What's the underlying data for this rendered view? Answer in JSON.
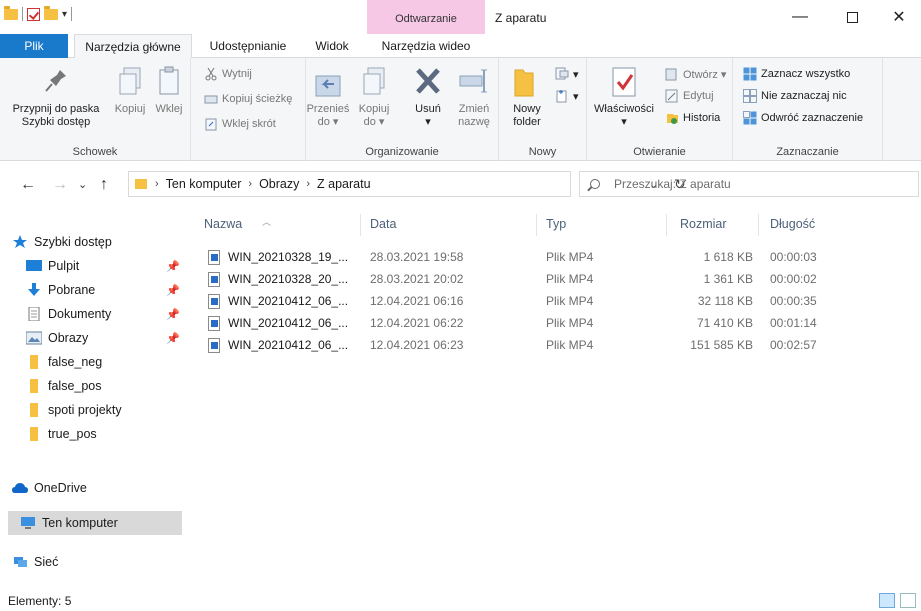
{
  "window": {
    "title": "Z aparatu",
    "context_tab_group": "Odtwarzanie",
    "minimize": "—",
    "close": "✕"
  },
  "tabs": {
    "file": "Plik",
    "home": "Narzędzia główne",
    "share": "Udostępnianie",
    "view": "Widok",
    "video": "Narzędzia wideo"
  },
  "ribbon": {
    "clipboard": {
      "label": "Schowek",
      "pin_line1": "Przypnij do paska",
      "pin_line2": "Szybki dostęp",
      "copy": "Kopiuj",
      "paste": "Wklej",
      "cut": "Wytnij",
      "copy_path": "Kopiuj ścieżkę",
      "paste_shortcut": "Wklej skrót"
    },
    "organize": {
      "label": "Organizowanie",
      "move_line1": "Przenieś",
      "move_line2": "do ▾",
      "copyto_line1": "Kopiuj",
      "copyto_line2": "do ▾",
      "delete_line1": "Usuń",
      "delete_line2": "▾",
      "rename_line1": "Zmień",
      "rename_line2": "nazwę"
    },
    "new": {
      "label": "Nowy",
      "new_folder_line1": "Nowy",
      "new_folder_line2": "folder"
    },
    "open": {
      "label": "Otwieranie",
      "properties_line1": "Właściwości",
      "properties_line2": "▾",
      "open": "Otwórz ▾",
      "edit": "Edytuj",
      "history": "Historia"
    },
    "select": {
      "label": "Zaznaczanie",
      "select_all": "Zaznacz wszystko",
      "select_none": "Nie zaznaczaj nic",
      "invert": "Odwróć zaznaczenie"
    }
  },
  "address": {
    "crumbs": [
      "Ten komputer",
      "Obrazy",
      "Z aparatu"
    ],
    "search_placeholder": "Przeszukaj: Z aparatu"
  },
  "sidebar": {
    "quick_access": "Szybki dostęp",
    "items": [
      {
        "label": "Pulpit",
        "pinned": true
      },
      {
        "label": "Pobrane",
        "pinned": true
      },
      {
        "label": "Dokumenty",
        "pinned": true
      },
      {
        "label": "Obrazy",
        "pinned": true
      },
      {
        "label": "false_neg",
        "pinned": false
      },
      {
        "label": "false_pos",
        "pinned": false
      },
      {
        "label": "spoti projekty",
        "pinned": false
      },
      {
        "label": "true_pos",
        "pinned": false
      }
    ],
    "onedrive": "OneDrive",
    "this_pc": "Ten komputer",
    "network": "Sieć"
  },
  "columns": {
    "name": "Nazwa",
    "date": "Data",
    "type": "Typ",
    "size": "Rozmiar",
    "duration": "Długość"
  },
  "files": [
    {
      "name": "WIN_20210328_19_...",
      "date": "28.03.2021 19:58",
      "type": "Plik MP4",
      "size": "1 618 KB",
      "duration": "00:00:03"
    },
    {
      "name": "WIN_20210328_20_...",
      "date": "28.03.2021 20:02",
      "type": "Plik MP4",
      "size": "1 361 KB",
      "duration": "00:00:02"
    },
    {
      "name": "WIN_20210412_06_...",
      "date": "12.04.2021 06:16",
      "type": "Plik MP4",
      "size": "32 118 KB",
      "duration": "00:00:35"
    },
    {
      "name": "WIN_20210412_06_...",
      "date": "12.04.2021 06:22",
      "type": "Plik MP4",
      "size": "71 410 KB",
      "duration": "00:01:14"
    },
    {
      "name": "WIN_20210412_06_...",
      "date": "12.04.2021 06:23",
      "type": "Plik MP4",
      "size": "151 585 KB",
      "duration": "00:02:57"
    }
  ],
  "status": {
    "items_count": "Elementy: 5"
  },
  "colors": {
    "accent": "#1979ca",
    "context_tab": "#f7c8e6",
    "folder": "#f6c142",
    "selection": "#d9d9d9"
  }
}
